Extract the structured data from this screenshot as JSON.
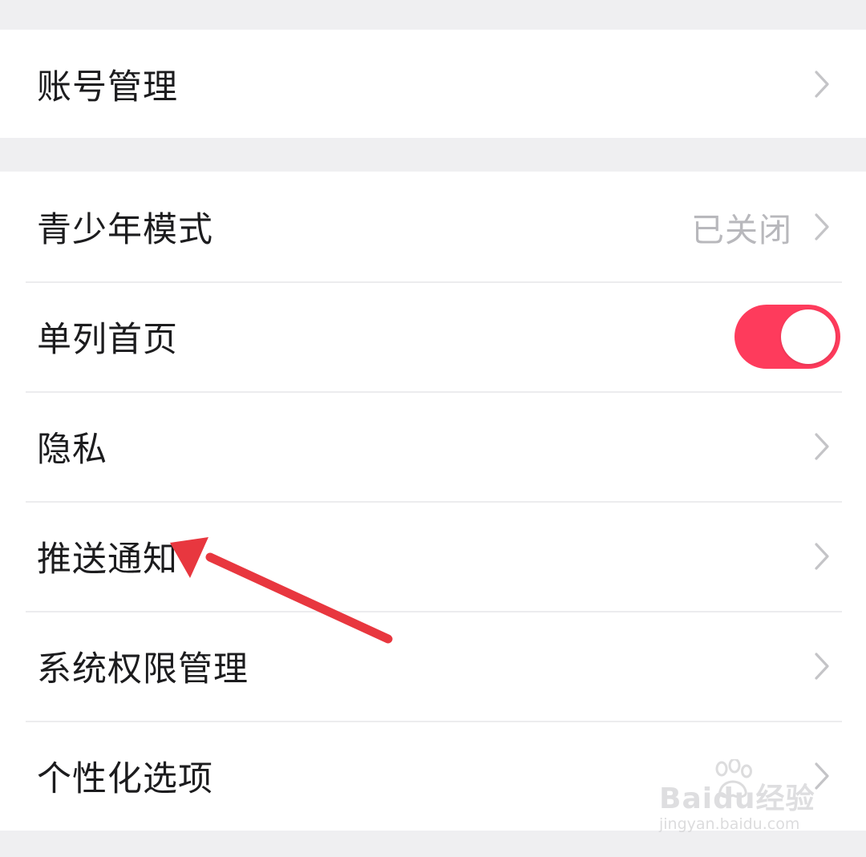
{
  "colors": {
    "background": "#efeff1",
    "card": "#ffffff",
    "label": "#1c1c1e",
    "secondary": "#b8b8bc",
    "chevron": "#c4c4c7",
    "toggle_on": "#fe3b5c",
    "annotation_arrow": "#e8373f"
  },
  "sections": [
    {
      "rows": [
        {
          "label": "账号管理",
          "control": "chevron",
          "icon": "chevron-right-icon"
        }
      ]
    },
    {
      "rows": [
        {
          "label": "青少年模式",
          "value": "已关闭",
          "control": "chevron",
          "icon": "chevron-right-icon"
        },
        {
          "label": "单列首页",
          "control": "toggle",
          "toggle_on": true
        },
        {
          "label": "隐私",
          "control": "chevron",
          "icon": "chevron-right-icon"
        },
        {
          "label": "推送通知",
          "control": "chevron",
          "icon": "chevron-right-icon",
          "annotated": true
        },
        {
          "label": "系统权限管理",
          "control": "chevron",
          "icon": "chevron-right-icon"
        },
        {
          "label": "个性化选项",
          "control": "chevron",
          "icon": "chevron-right-icon"
        }
      ]
    }
  ],
  "watermark": {
    "brand": "Baidu经验",
    "url": "jingyan.baidu.com",
    "icon": "baidu-paw-icon"
  }
}
